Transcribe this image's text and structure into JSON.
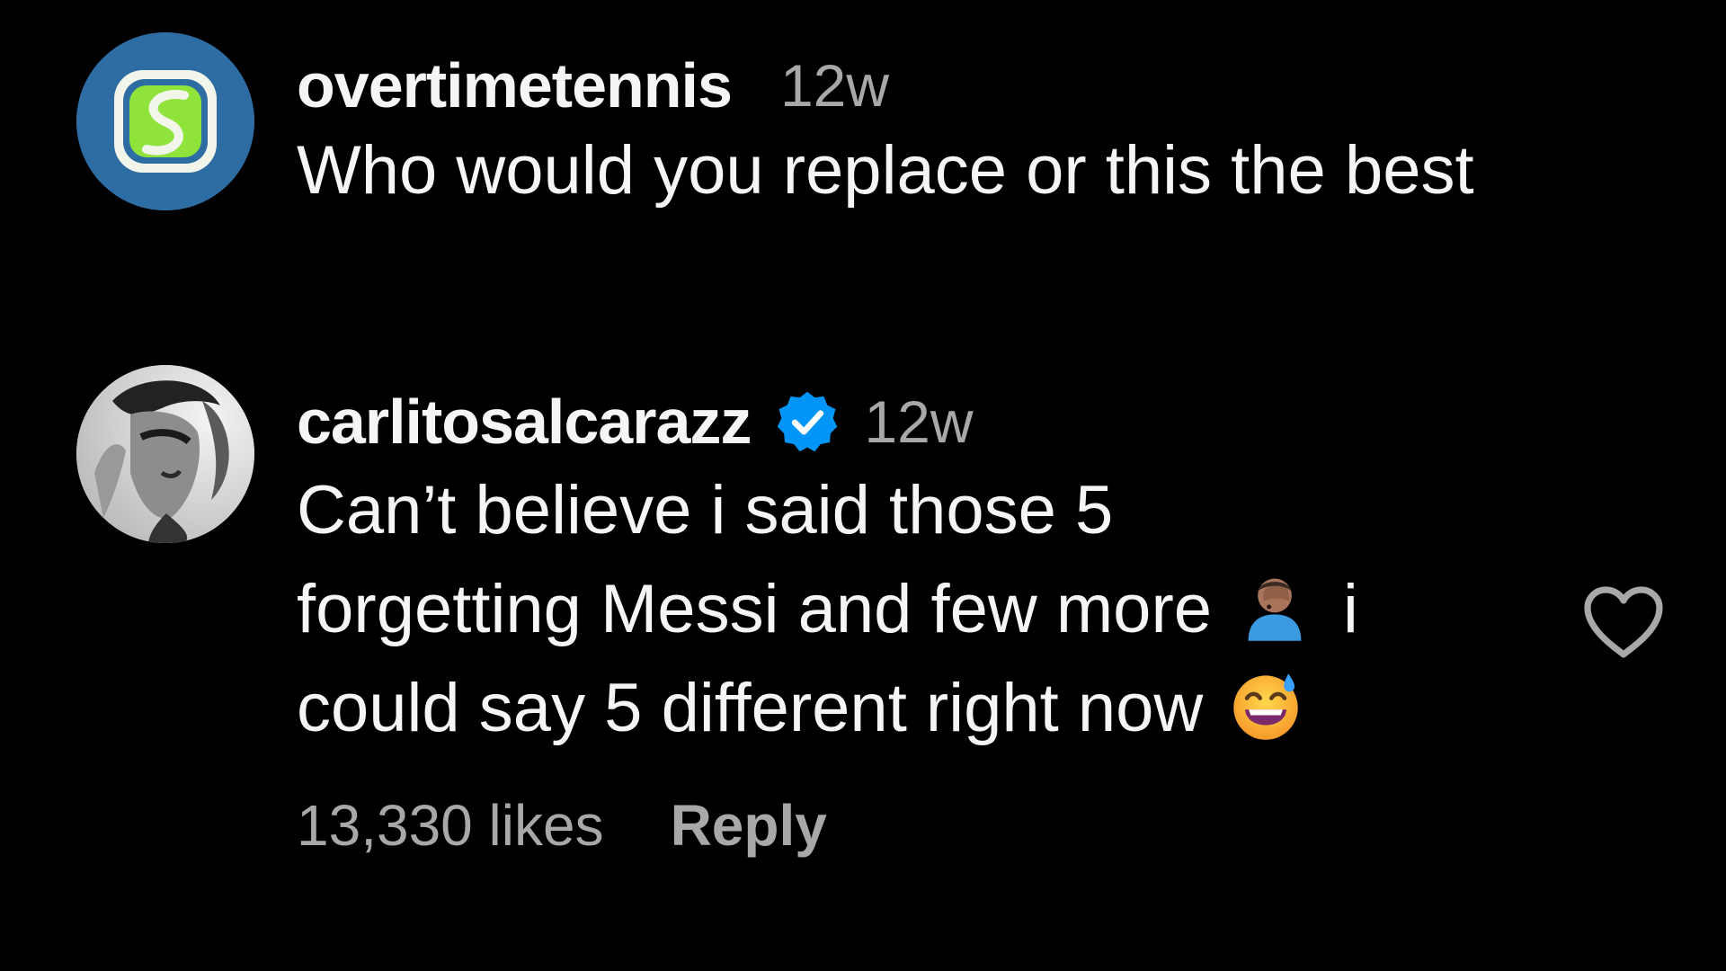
{
  "comments": [
    {
      "username": "overtimetennis",
      "timestamp": "12w",
      "text_lines": [
        "Who would you replace or this the best"
      ],
      "avatar_icon": "overtime-logo-icon",
      "avatar_color": "#2e6da4",
      "logo_accent": "#8fe33a"
    },
    {
      "username": "carlitosalcarazz",
      "verified": true,
      "verified_color": "#0095f6",
      "timestamp": "12w",
      "text_lines": [
        "Can’t believe i said those 5",
        "forgetting Messi and few more",
        "i",
        "could say 5 different right now"
      ],
      "emojis": [
        "person-facepalming-emoji",
        "grinning-face-with-sweat-emoji"
      ],
      "likes_label": "13,330 likes",
      "reply_label": "Reply",
      "like_icon": "heart-outline-icon"
    }
  ],
  "colors": {
    "background": "#000000",
    "primary_text": "#f5f5f5",
    "secondary_text": "#a8a8a8"
  }
}
